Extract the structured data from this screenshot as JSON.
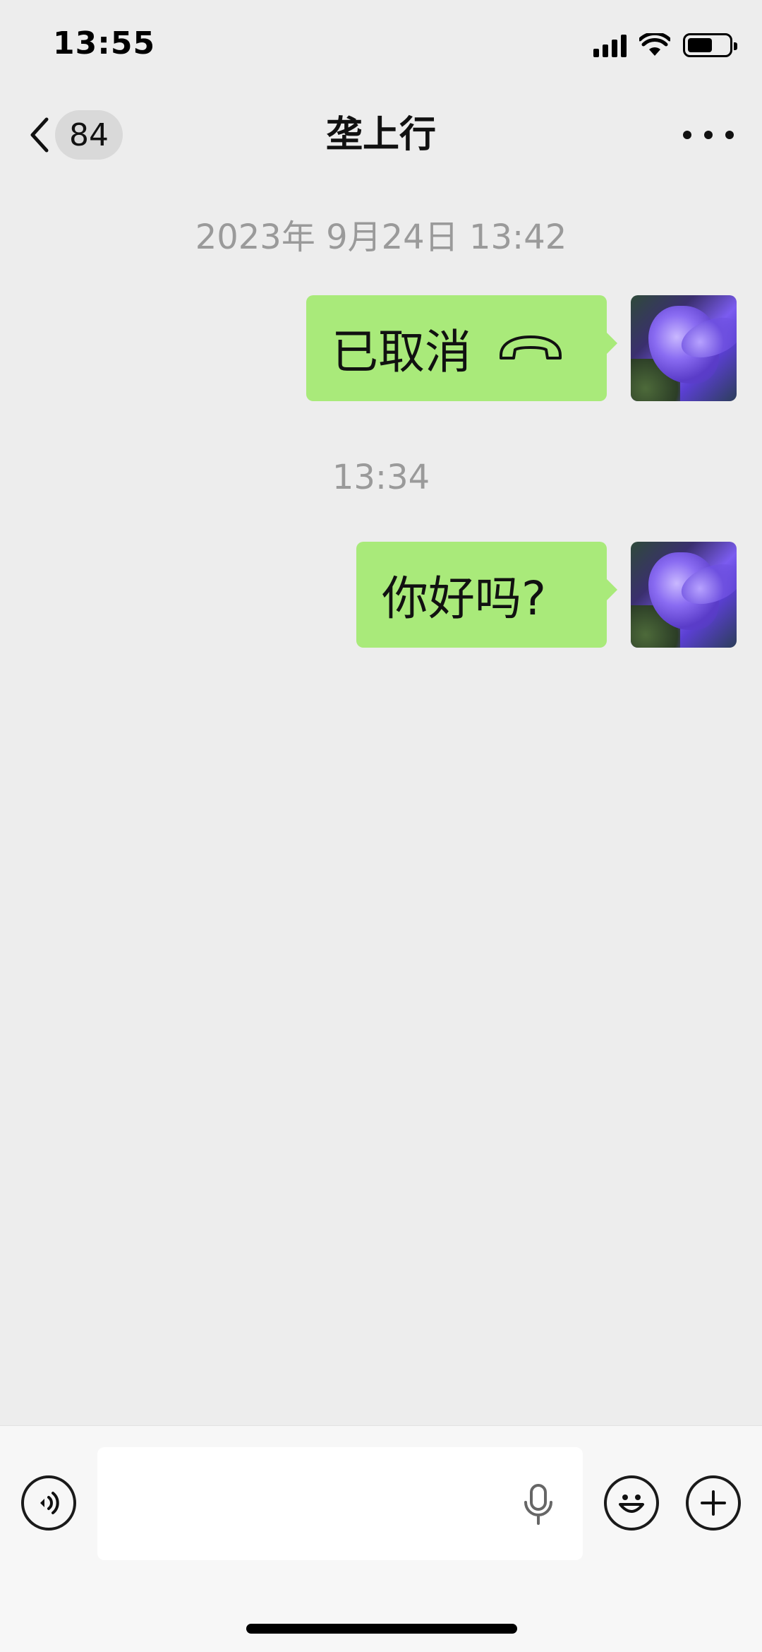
{
  "status_bar": {
    "time": "13:55"
  },
  "nav": {
    "unread_count": "84",
    "title": "垄上行"
  },
  "chat": {
    "timestamps": [
      "2023年 9月24日 13:42",
      "13:34"
    ],
    "messages": [
      {
        "text": "已取消",
        "type": "call-cancelled",
        "icon": "phone-hangup-icon"
      },
      {
        "text": "你好吗?",
        "type": "text"
      }
    ]
  },
  "input_bar": {
    "placeholder": ""
  },
  "colors": {
    "background": "#EDEDED",
    "bubble_sent": "#A9EA7A",
    "timestamp_text": "#9A9A9A",
    "input_bar_bg": "#F7F7F7"
  }
}
